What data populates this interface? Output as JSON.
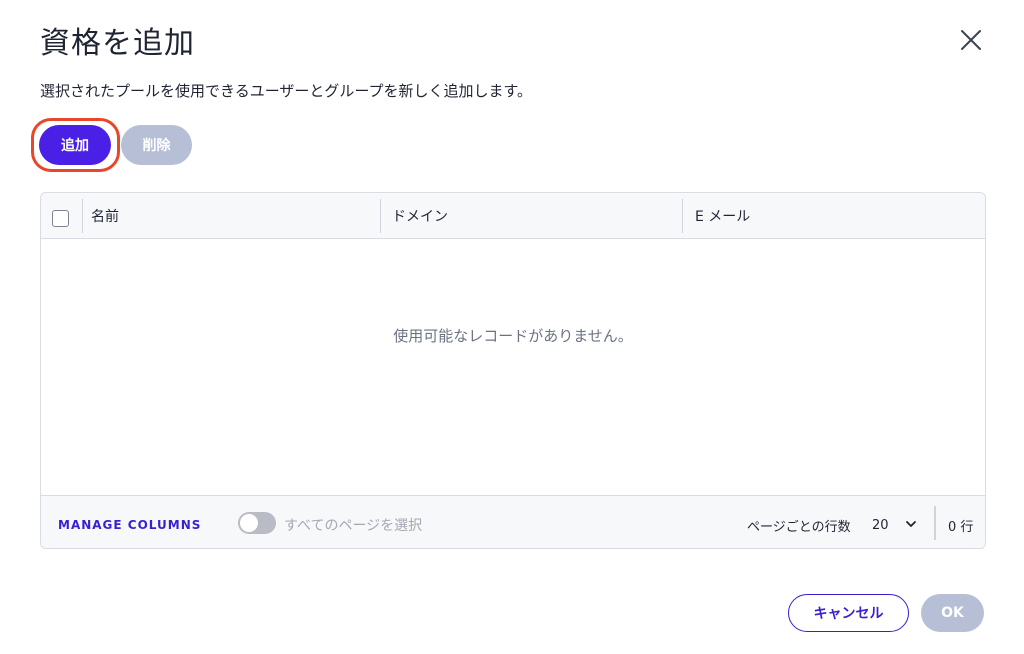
{
  "dialog": {
    "title": "資格を追加",
    "description": "選択されたプールを使用できるユーザーとグループを新しく追加します。"
  },
  "toolbar": {
    "add_label": "追加",
    "delete_label": "削除"
  },
  "table": {
    "columns": [
      "名前",
      "ドメイン",
      "E メール"
    ],
    "rows": [],
    "empty_message": "使用可能なレコードがありません。"
  },
  "footer": {
    "manage_columns": "MANAGE COLUMNS",
    "select_all_pages": "すべてのページを選択",
    "rows_per_page_label": "ページごとの行数",
    "rows_per_page_value": "20",
    "row_count": "0 行"
  },
  "actions": {
    "cancel_label": "キャンセル",
    "ok_label": "OK"
  },
  "colors": {
    "primary": "#4a1fe6",
    "disabled": "#b7bfd6",
    "highlight_ring": "#e8472b"
  }
}
